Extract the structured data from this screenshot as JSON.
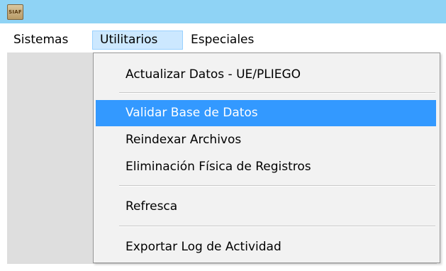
{
  "window": {
    "icon_text": "SIAF"
  },
  "menubar": {
    "items": [
      {
        "label": "Sistemas"
      },
      {
        "label": "Utilitarios"
      },
      {
        "label": "Especiales"
      }
    ]
  },
  "dropdown": {
    "items": [
      {
        "label": "Actualizar Datos - UE/PLIEGO"
      },
      {
        "label": "Validar Base de Datos",
        "highlighted": true
      },
      {
        "label": "Reindexar Archivos"
      },
      {
        "label": "Eliminación Física de Registros"
      },
      {
        "label": "Refresca"
      },
      {
        "label": "Exportar Log de Actividad"
      }
    ]
  },
  "colors": {
    "titlebar": "#8fd3f5",
    "menubar_active": "#cce8ff",
    "highlight": "#3399ff",
    "menu_background": "#f2f2f2",
    "client_background": "#dedede"
  }
}
